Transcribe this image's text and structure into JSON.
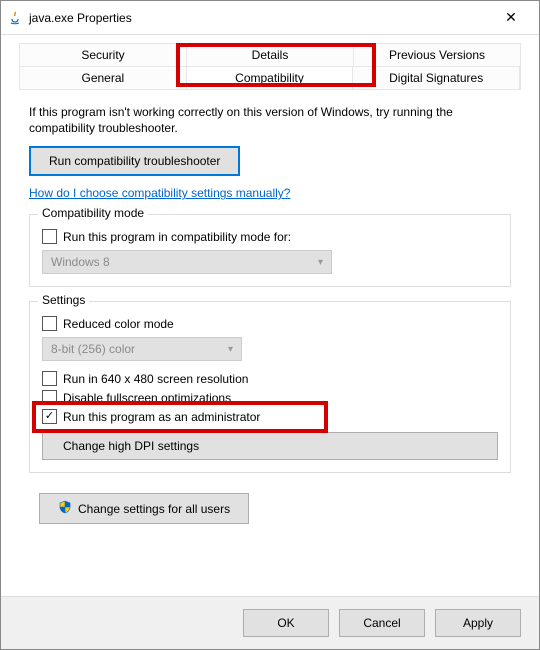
{
  "window": {
    "title": "java.exe Properties",
    "close": "✕"
  },
  "tabs": {
    "row1": [
      "Security",
      "Details",
      "Previous Versions"
    ],
    "row2": [
      "General",
      "Compatibility",
      "Digital Signatures"
    ],
    "active": "Compatibility"
  },
  "intro": "If this program isn't working correctly on this version of Windows, try running the compatibility troubleshooter.",
  "troubleshooter_btn": "Run compatibility troubleshooter",
  "help_link": "How do I choose compatibility settings manually?",
  "compat_mode": {
    "title": "Compatibility mode",
    "checkbox_label": "Run this program in compatibility mode for:",
    "select_value": "Windows 8"
  },
  "settings": {
    "title": "Settings",
    "reduced_color": "Reduced color mode",
    "color_select": "8-bit (256) color",
    "run_640": "Run in 640 x 480 screen resolution",
    "disable_fullscreen": "Disable fullscreen optimizations",
    "run_admin": "Run this program as an administrator",
    "run_admin_checked": true,
    "dpi_btn": "Change high DPI settings"
  },
  "all_users_btn": "Change settings for all users",
  "footer": {
    "ok": "OK",
    "cancel": "Cancel",
    "apply": "Apply"
  }
}
